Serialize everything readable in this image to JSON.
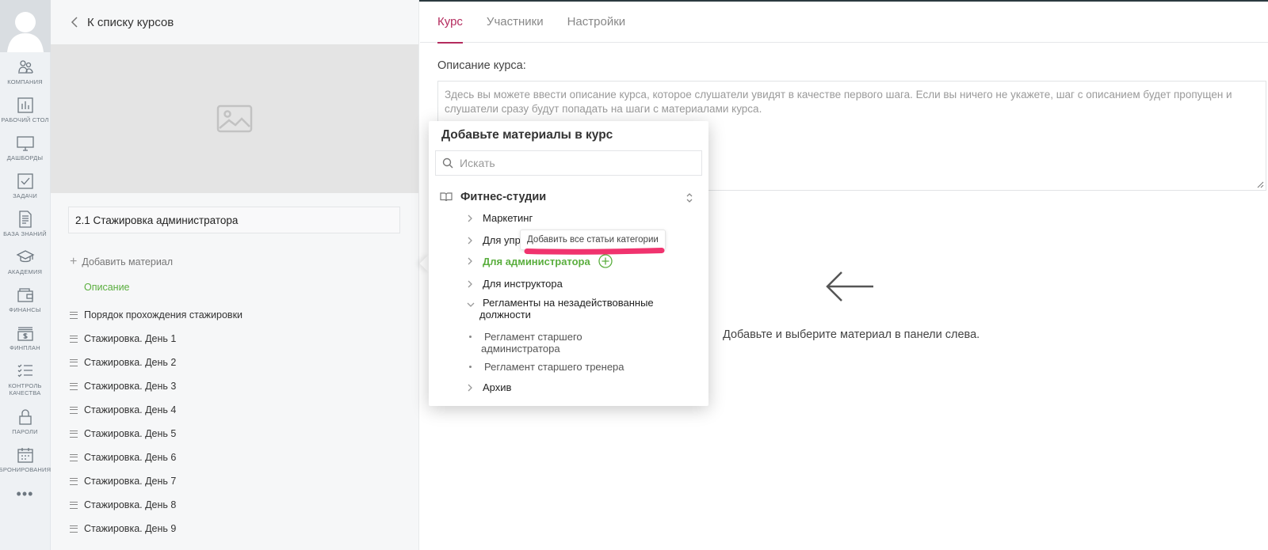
{
  "rail": {
    "items": [
      {
        "label": "КОМПАНИЯ",
        "icon": "company-icon"
      },
      {
        "label": "РАБОЧИЙ СТОЛ",
        "icon": "bar-chart-icon"
      },
      {
        "label": "ДАШБОРДЫ",
        "icon": "monitor-icon"
      },
      {
        "label": "ЗАДАЧИ",
        "icon": "checkbox-icon"
      },
      {
        "label": "БАЗА ЗНАНИЙ",
        "icon": "document-icon"
      },
      {
        "label": "АКАДЕМИЯ",
        "icon": "graduation-cap-icon"
      },
      {
        "label": "ФИНАНСЫ",
        "icon": "wallet-icon"
      },
      {
        "label": "ФИНПЛАН",
        "icon": "money-stack-icon"
      },
      {
        "label_line1": "КОНТРОЛЬ",
        "label_line2": "КАЧЕСТВА",
        "icon": "checklist-icon"
      },
      {
        "label": "ПАРОЛИ",
        "icon": "lock-icon"
      },
      {
        "label": "БРОНИРОВАНИЯ",
        "icon": "calendar-icon"
      }
    ],
    "more": "•••"
  },
  "panel": {
    "back_label": "К списку курсов",
    "course_title": "2.1 Стажировка администратора",
    "add_material_label": "Добавить материал",
    "description_link": "Описание",
    "steps": [
      "Порядок прохождения стажировки",
      "Стажировка. День 1",
      "Стажировка. День 2",
      "Стажировка. День 3",
      "Стажировка. День 4",
      "Стажировка. День 5",
      "Стажировка. День 6",
      "Стажировка. День 7",
      "Стажировка. День 8",
      "Стажировка. День 9"
    ]
  },
  "main": {
    "tabs": [
      "Курс",
      "Участники",
      "Настройки"
    ],
    "active_tab": "Курс",
    "description_label": "Описание курса:",
    "description_placeholder": "Здесь вы можете ввести описание курса, которое слушатели увидят в качестве первого шага. Если вы ничего не укажете, шаг с описанием будет пропущен и слушатели сразу будут попадать на шаги с материалами курса.",
    "empty_state_text": "Добавьте и выберите материал в панели слева."
  },
  "popup": {
    "title": "Добавьте материалы в курс",
    "search_placeholder": "Искать",
    "category": "Фитнес-студии",
    "tree": {
      "marketing": "Маркетинг",
      "for_managers_truncated": "Для упр",
      "for_admin": "Для администратора",
      "for_instructor": "Для инструктора",
      "regulations_line1": "Регламенты на незадействованные",
      "regulations_line2": "должности",
      "leaf1_line1": "Регламент старшего",
      "leaf1_line2": "администратора",
      "leaf2": "Регламент старшего тренера",
      "archive": "Архив"
    },
    "tooltip": "Добавить все статьи категории"
  },
  "colors": {
    "accent": "#b42b5e",
    "green": "#5aae3e",
    "highlight": "#f0336e"
  }
}
